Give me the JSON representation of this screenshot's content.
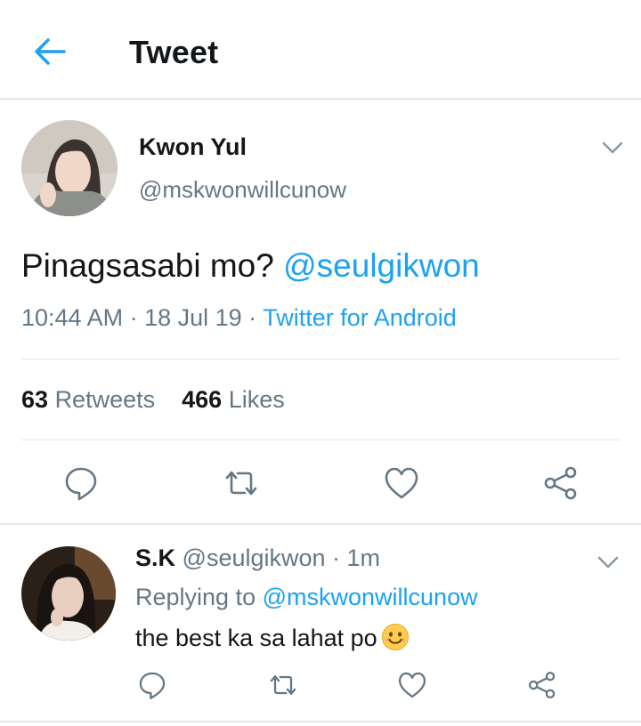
{
  "header": {
    "title": "Tweet",
    "back_icon": "arrow-left-icon"
  },
  "colors": {
    "accent": "#1da1f2",
    "muted": "#657786",
    "text": "#14171a",
    "divider": "#e1e8ed"
  },
  "tweet": {
    "author_name": "Kwon Yul",
    "author_handle": "@mskwonwillcunow",
    "text": "Pinagsasabi mo?",
    "mention": "@seulgikwon",
    "time": "10:44 AM",
    "separator": " · ",
    "date": "18 Jul 19",
    "source": "Twitter for Android",
    "retweets_count": "63",
    "retweets_label": "Retweets",
    "likes_count": "466",
    "likes_label": "Likes",
    "actions": [
      "reply-icon",
      "retweet-icon",
      "like-icon",
      "share-icon"
    ]
  },
  "reply": {
    "author_name": "S.K",
    "author_handle": "@seulgikwon",
    "time": "1m",
    "separator": " · ",
    "replying_prefix": "Replying to",
    "replying_to": "@mskwonwillcunow",
    "text": "the best ka sa lahat po",
    "emoji": "smiling-face-emoji",
    "actions": [
      "reply-icon",
      "retweet-icon",
      "like-icon",
      "share-icon"
    ]
  }
}
